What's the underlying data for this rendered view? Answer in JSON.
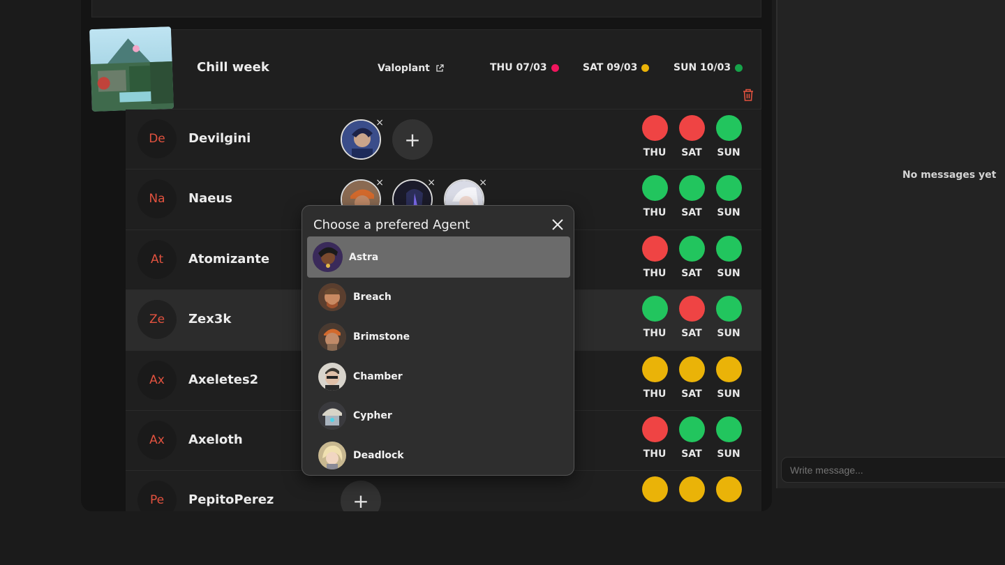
{
  "event": {
    "title": "Chill week",
    "map": "Valoplant",
    "dates": [
      {
        "label": "THU 07/03",
        "color": "#f0155d"
      },
      {
        "label": "SAT 09/03",
        "color": "#eab308"
      },
      {
        "label": "SUN 10/03",
        "color": "#16a34a"
      }
    ]
  },
  "day_labels": [
    "THU",
    "SAT",
    "SUN"
  ],
  "players": [
    {
      "initials": "De",
      "name": "Devilgini",
      "availability": [
        "red",
        "red",
        "green"
      ]
    },
    {
      "initials": "Na",
      "name": "Naeus",
      "availability": [
        "green",
        "green",
        "green"
      ]
    },
    {
      "initials": "At",
      "name": "Atomizante",
      "availability": [
        "red",
        "green",
        "green"
      ]
    },
    {
      "initials": "Ze",
      "name": "Zex3k",
      "availability": [
        "green",
        "red",
        "green"
      ]
    },
    {
      "initials": "Ax",
      "name": "Axeletes2",
      "availability": [
        "yellow",
        "yellow",
        "yellow"
      ]
    },
    {
      "initials": "Ax",
      "name": "Axeloth",
      "availability": [
        "red",
        "green",
        "green"
      ]
    },
    {
      "initials": "Pe",
      "name": "PepitoPerez",
      "availability": [
        "yellow",
        "yellow",
        "yellow"
      ]
    }
  ],
  "add_symbol": "+",
  "remove_symbol": "×",
  "chat": {
    "empty_text": "No messages yet",
    "input_placeholder": "Write message..."
  },
  "modal": {
    "title": "Choose a prefered Agent",
    "agents": [
      "Astra",
      "Breach",
      "Brimstone",
      "Chamber",
      "Cypher",
      "Deadlock"
    ],
    "selected": "Astra"
  }
}
